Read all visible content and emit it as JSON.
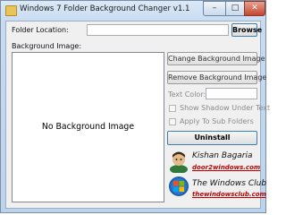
{
  "window": {
    "title": "Windows 7 Folder Background Changer v1.1"
  },
  "folder_location": {
    "label": "Folder Location:",
    "value": "",
    "browse_label": "Browse"
  },
  "background_image": {
    "label": "Background Image:",
    "placeholder_text": "No Background Image"
  },
  "buttons": {
    "change_background": "Change Background Image",
    "remove_background": "Remove Background Image",
    "uninstall": "Uninstall"
  },
  "options": {
    "text_color_label": "Text Color:",
    "text_color_value": "",
    "show_shadow_label": "Show Shadow Under Text",
    "show_shadow_checked": false,
    "apply_sub_folders_label": "Apply To Sub Folders",
    "apply_sub_folders_checked": false
  },
  "credits": [
    {
      "name": "Kishan Bagaria",
      "link": "door2windows.com",
      "icon": "person-avatar-icon"
    },
    {
      "name": "The Windows Club",
      "link": "thewindowsclub.com",
      "icon": "windows-logo-icon"
    }
  ],
  "colors": {
    "link": "#c00000",
    "title_bar": "#c7dbf0",
    "close_button": "#c4472f"
  }
}
